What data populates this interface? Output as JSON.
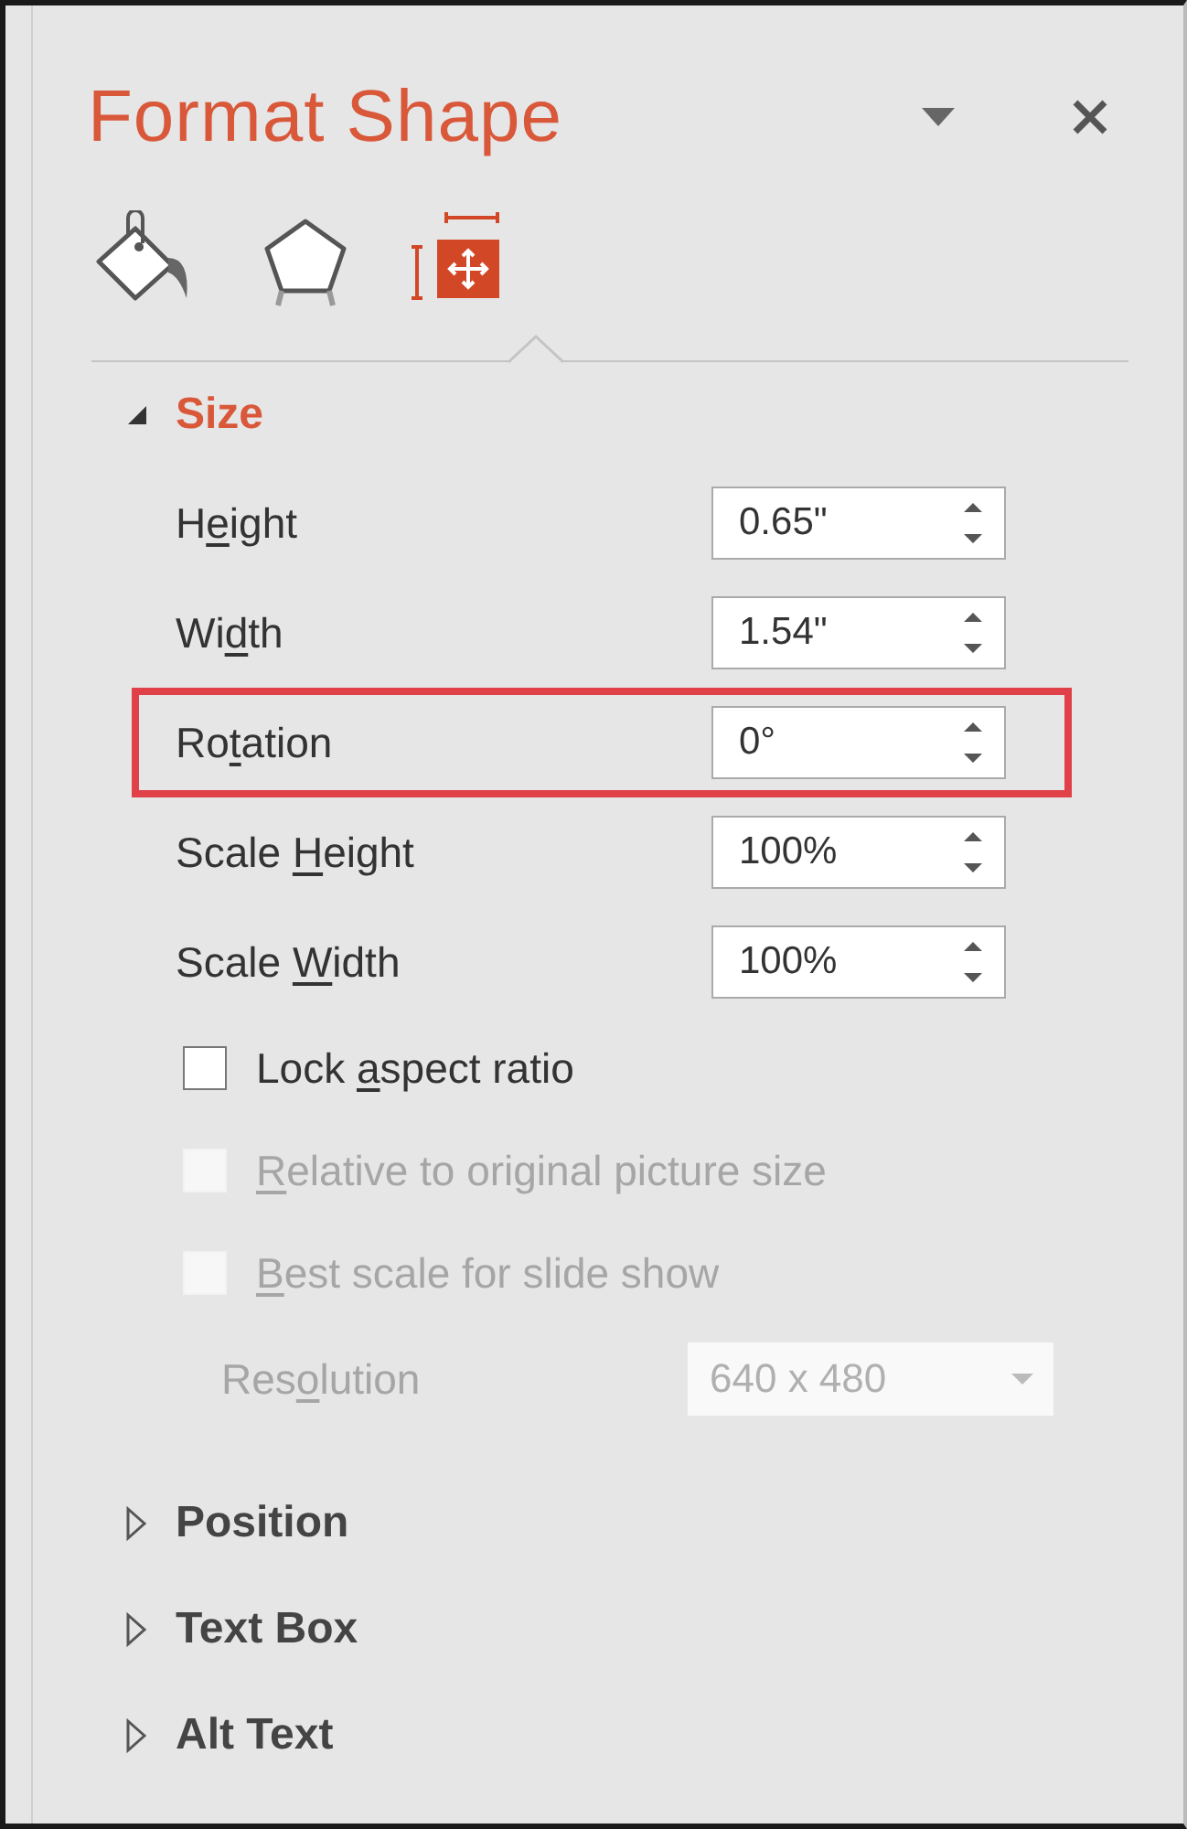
{
  "panel": {
    "title": "Format Shape",
    "tabs": [
      {
        "kind": "fill",
        "selected": false
      },
      {
        "kind": "shape",
        "selected": false
      },
      {
        "kind": "size",
        "selected": true
      }
    ],
    "sections": [
      {
        "title": "Size",
        "expanded": true,
        "fields": [
          {
            "label": [
              {
                "text": "H",
                "underlined": false
              },
              {
                "text": "e",
                "underlined": true
              },
              {
                "text": "ight",
                "underlined": false
              }
            ],
            "value": "0.65\"",
            "highlighted": false
          },
          {
            "label": [
              {
                "text": "Wi",
                "underlined": false
              },
              {
                "text": "d",
                "underlined": true
              },
              {
                "text": "th",
                "underlined": false
              }
            ],
            "value": "1.54\"",
            "highlighted": false
          },
          {
            "label": [
              {
                "text": "Ro",
                "underlined": false
              },
              {
                "text": "t",
                "underlined": true
              },
              {
                "text": "ation",
                "underlined": false
              }
            ],
            "value": "0°",
            "highlighted": true
          },
          {
            "label": [
              {
                "text": "Scale ",
                "underlined": false
              },
              {
                "text": "H",
                "underlined": true
              },
              {
                "text": "eight",
                "underlined": false
              }
            ],
            "value": "100%",
            "highlighted": false
          },
          {
            "label": [
              {
                "text": "Scale ",
                "underlined": false
              },
              {
                "text": "W",
                "underlined": true
              },
              {
                "text": "idth",
                "underlined": false
              }
            ],
            "value": "100%",
            "highlighted": false
          }
        ],
        "checkboxes": [
          {
            "label": [
              {
                "text": "Lock ",
                "underlined": false
              },
              {
                "text": "a",
                "underlined": true
              },
              {
                "text": "spect ratio",
                "underlined": false
              }
            ],
            "checked": false,
            "disabled": false
          },
          {
            "label": [
              {
                "text": "R",
                "underlined": true
              },
              {
                "text": "elative to original picture size",
                "underlined": false
              }
            ],
            "checked": false,
            "disabled": true
          },
          {
            "label": [
              {
                "text": "B",
                "underlined": true
              },
              {
                "text": "est scale for slide show",
                "underlined": false
              }
            ],
            "checked": false,
            "disabled": true
          }
        ],
        "dropdown": {
          "label": [
            {
              "text": "Res",
              "underlined": false
            },
            {
              "text": "o",
              "underlined": true
            },
            {
              "text": "lution",
              "underlined": false
            }
          ],
          "value": "640 x 480",
          "disabled": true
        }
      },
      {
        "title": "Position",
        "expanded": false
      },
      {
        "title": "Text Box",
        "expanded": false
      },
      {
        "title": "Alt Text",
        "expanded": false
      }
    ]
  }
}
